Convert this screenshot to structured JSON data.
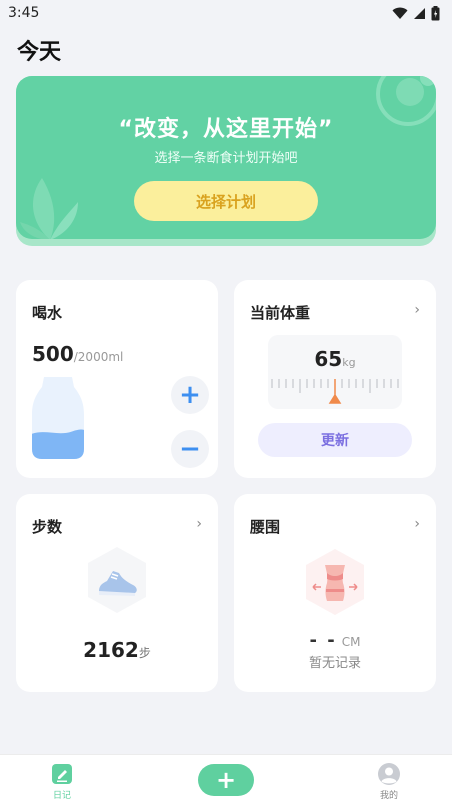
{
  "status_bar": {
    "time": "3:45",
    "icons": [
      "wifi-icon",
      "cell-signal-icon",
      "battery-icon"
    ]
  },
  "page": {
    "title": "今天"
  },
  "banner": {
    "title": "“改变，从这里开始”",
    "subtitle": "选择一条断食计划开始吧",
    "button_label": "选择计划"
  },
  "water": {
    "title": "喝水",
    "amount": "500",
    "goal": "/2000ml",
    "fill_fraction": 0.25,
    "add_icon": "+",
    "subtract_icon": "−"
  },
  "weight": {
    "title": "当前体重",
    "chevron": "›",
    "value": "65",
    "unit": "kg",
    "update_label": "更新"
  },
  "steps": {
    "title": "步数",
    "chevron": "›",
    "value": "2162",
    "unit": "步"
  },
  "waist": {
    "title": "腰围",
    "chevron": "›",
    "value": "- -",
    "unit": "CM",
    "empty_text": "暂无记录"
  },
  "bottom_nav": {
    "diary_label": "日记",
    "add_icon": "+",
    "profile_label": "我的"
  },
  "colors": {
    "accent_green": "#62d2a4",
    "button_yellow": "#fbef9c",
    "water_blue": "#7fb6f5",
    "update_purple": "#7b6fe0",
    "ruler_marker": "#f08a4b"
  }
}
